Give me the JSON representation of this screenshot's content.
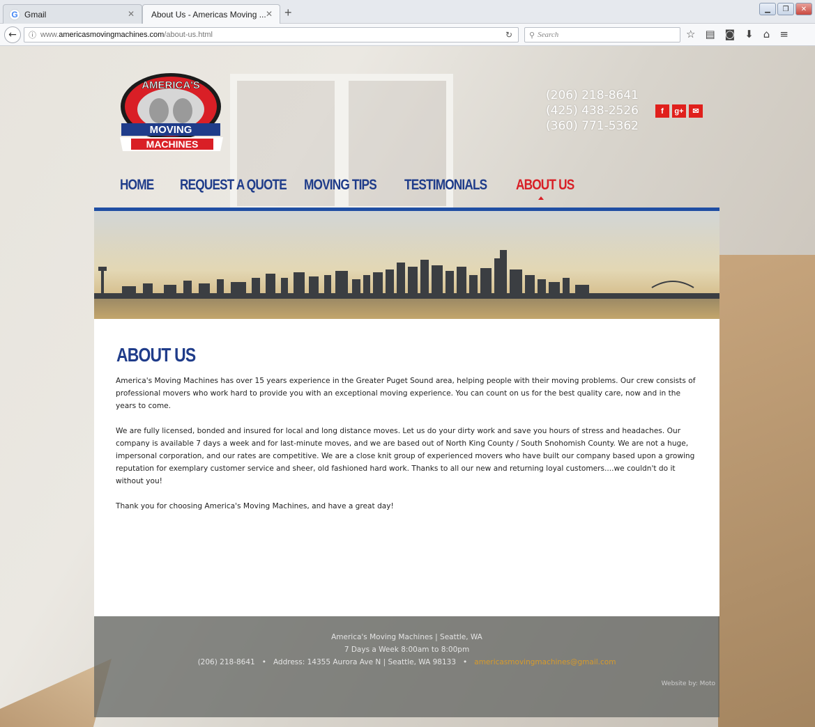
{
  "browser": {
    "tabs": [
      {
        "label": "Gmail",
        "active": false
      },
      {
        "label": "About Us - Americas Moving ...",
        "active": true
      }
    ],
    "url_prefix": "www.",
    "url_domain": "americasmovingmachines.com",
    "url_path": "/about-us.html",
    "search_placeholder": "Search"
  },
  "header": {
    "logo": {
      "line1": "AMERICA'S",
      "line2": "MOVING",
      "line3": "MACHINES"
    },
    "phones": [
      "(206) 218-8641",
      "(425) 438-2526",
      "(360) 771-5362"
    ],
    "social": [
      "f",
      "g+",
      "✉"
    ]
  },
  "nav": {
    "items": [
      "HOME",
      "REQUEST A QUOTE",
      "MOVING TIPS",
      "TESTIMONIALS",
      "ABOUT US"
    ],
    "current_index": 4
  },
  "main": {
    "title": "ABOUT US",
    "paragraphs": [
      "America's Moving Machines has over 15 years experience in the Greater Puget Sound area, helping people with their moving problems. Our crew consists of professional movers who work hard to provide you with an exceptional moving experience. You can count on us for the best quality care, now and in the years to come.",
      "We are fully licensed, bonded and insured for local and long distance moves. Let us do your dirty work and save you hours of stress and headaches. Our company is available 7 days a week and for last-minute moves, and we are based out of North King County / South Snohomish County. We are not a huge, impersonal corporation, and our rates are competitive. We are a close knit group of experienced movers who have built our company based upon a growing reputation for exemplary customer service and sheer, old fashioned hard work. Thanks to all our new and returning loyal customers....we couldn't do it without you!",
      "Thank you for choosing America's Moving Machines, and have a great day!"
    ]
  },
  "footer": {
    "line1": "America's Moving Machines   |   Seattle, WA",
    "line2": "7 Days a Week 8:00am to 8:00pm",
    "phone": "(206) 218-8641",
    "address": "Address: 14355 Aurora Ave N | Seattle, WA 98133",
    "email": "americasmovingmachines@gmail.com",
    "credit": "Website by: Moto"
  },
  "colors": {
    "nav_blue": "#1f3c8a",
    "accent_red": "#d81f26",
    "bar_blue": "#1f4ea3",
    "email_orange": "#d69a2c"
  }
}
